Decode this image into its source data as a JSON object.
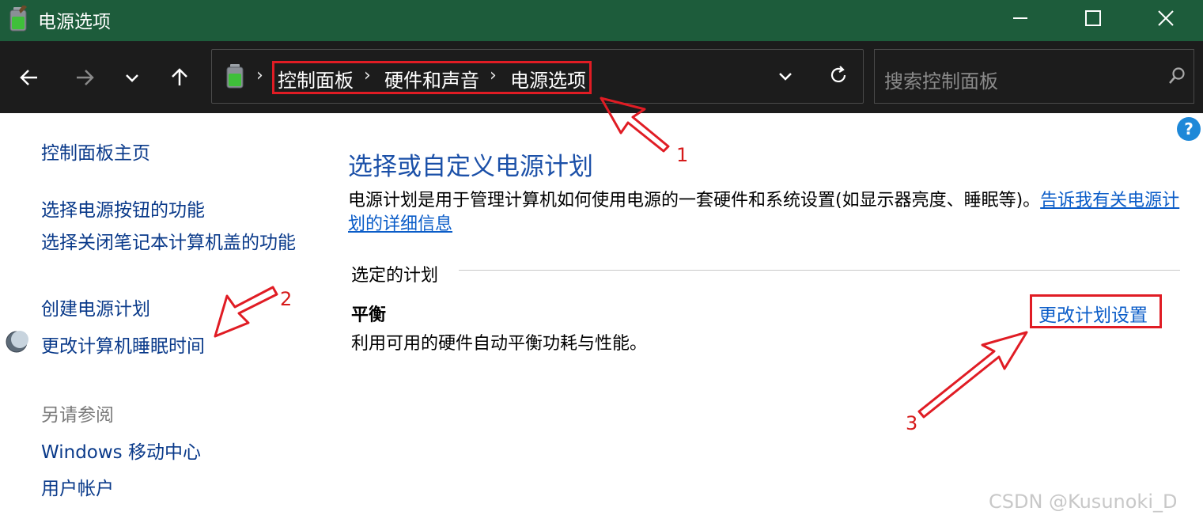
{
  "window": {
    "title": "电源选项"
  },
  "nav": {
    "breadcrumb": [
      "控制面板",
      "硬件和声音",
      "电源选项"
    ],
    "search_placeholder": "搜索控制面板"
  },
  "sidebar": {
    "home": "控制面板主页",
    "links": [
      "选择电源按钮的功能",
      "选择关闭笔记本计算机盖的功能",
      "创建电源计划",
      "更改计算机睡眠时间"
    ],
    "see_also_heading": "另请参阅",
    "see_also": [
      "Windows 移动中心",
      "用户帐户"
    ]
  },
  "main": {
    "title": "选择或自定义电源计划",
    "description": "电源计划是用于管理计算机如何使用电源的一套硬件和系统设置(如显示器亮度、睡眠等)。",
    "learn_more_link": "告诉我有关电源计划的详细信息",
    "section_label": "选定的计划",
    "plan_name": "平衡",
    "plan_description": "利用可用的硬件自动平衡功耗与性能。",
    "change_plan_link": "更改计划设置"
  },
  "annotations": {
    "labels": [
      "1",
      "2",
      "3"
    ],
    "color": "#e01c24"
  },
  "watermark": "CSDN @Kusunoki_D",
  "colors": {
    "titlebar": "#1d5c3b",
    "navbar": "#1c1c1c",
    "link": "#0a5cc8",
    "heading": "#1b50a8"
  }
}
